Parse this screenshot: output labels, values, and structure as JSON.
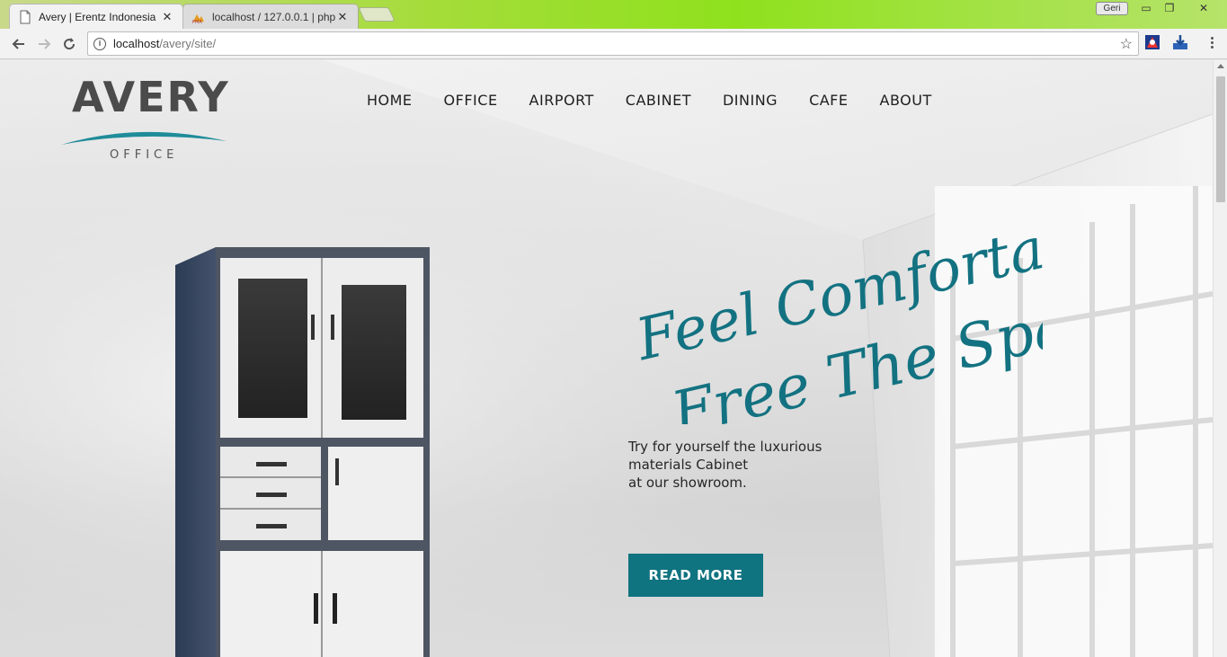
{
  "browser": {
    "tabs": [
      {
        "label": "Avery | Erentz Indonesia",
        "active": true,
        "icon": "page-icon"
      },
      {
        "label": "localhost / 127.0.0.1 | php",
        "active": false,
        "icon": "phpmyadmin-icon"
      }
    ],
    "profile_label": "Geri",
    "window_controls": {
      "minimize": "▭",
      "restore": "❐",
      "close": "✕"
    },
    "url_host": "localhost",
    "url_path": "/avery/site/"
  },
  "site": {
    "logo": {
      "title": "AVERY",
      "subtitle": "OFFICE",
      "accent": "#1f8c99"
    },
    "nav": [
      "HOME",
      "OFFICE",
      "AIRPORT",
      "CABINET",
      "DINING",
      "CAFE",
      "ABOUT"
    ],
    "hero": {
      "tagline_line1": "Feel Comfortable !",
      "tagline_line2": "Free The Space",
      "description": [
        "Try for yourself the luxurious",
        "materials Cabinet",
        "at our showroom."
      ],
      "cta_label": "READ MORE"
    },
    "colors": {
      "accent": "#107380",
      "script": "#137281"
    }
  }
}
